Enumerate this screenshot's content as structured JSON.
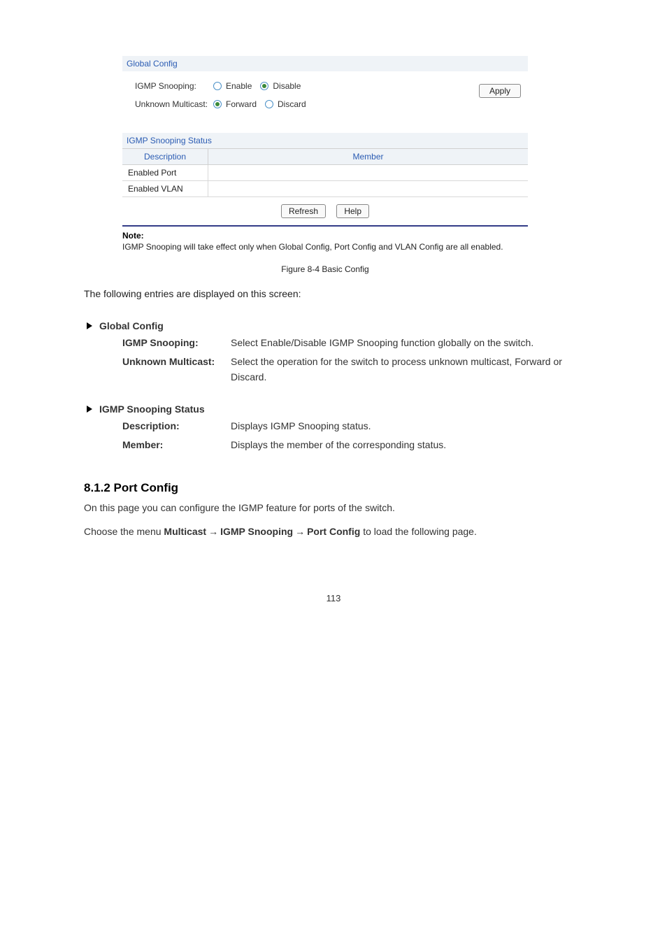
{
  "globalConfig": {
    "title": "Global Config",
    "igmpLabel": "IGMP Snooping:",
    "enable": "Enable",
    "disable": "Disable",
    "unknownLabel": "Unknown Multicast:",
    "forward": "Forward",
    "discard": "Discard",
    "applyLabel": "Apply"
  },
  "statusTable": {
    "title": "IGMP Snooping Status",
    "headerDesc": "Description",
    "headerMember": "Member",
    "rows": [
      {
        "desc": "Enabled Port",
        "member": ""
      },
      {
        "desc": "Enabled VLAN",
        "member": ""
      }
    ],
    "refreshLabel": "Refresh",
    "helpLabel": "Help"
  },
  "note": {
    "title": "Note:",
    "body": "IGMP Snooping will take effect only when Global Config, Port Config and VLAN Config are all enabled."
  },
  "figureCaption": "Figure 8-4 Basic Config",
  "intro": "The following entries are displayed on this screen:",
  "sectionGlobal": {
    "heading": "Global Config",
    "items": [
      {
        "term": "IGMP Snooping:",
        "body": "Select Enable/Disable IGMP Snooping function globally on the switch."
      },
      {
        "term": "Unknown Multicast:",
        "body": "Select the operation for the switch to process unknown multicast, Forward or Discard."
      }
    ]
  },
  "sectionStatus": {
    "heading": "IGMP Snooping Status",
    "items": [
      {
        "term": "Description:",
        "body": "Displays IGMP Snooping status."
      },
      {
        "term": "Member:",
        "body": "Displays the member of the corresponding status."
      }
    ]
  },
  "portConfig": {
    "sectionNumber": "8.1.2 Port Config",
    "para": "On this page you can configure the IGMP feature for ports of the switch.",
    "breadcrumb": {
      "prefix": "Choose the menu",
      "p1": "Multicast",
      "p2": "IGMP Snooping",
      "p3": "Port Config",
      "suffix": "to load the following page."
    }
  },
  "pageNumber": "113"
}
